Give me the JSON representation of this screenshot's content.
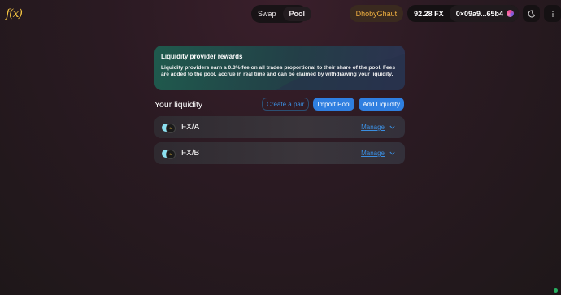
{
  "header": {
    "logo": "f(x)",
    "tabs": [
      {
        "label": "Swap"
      },
      {
        "label": "Pool"
      }
    ],
    "network": "DhobyGhaut",
    "balance": "92.28 FX",
    "address": "0×09a9...65b4"
  },
  "banner": {
    "title": "Liquidity provider rewards",
    "body": "Liquidity providers earn a 0.3% fee on all trades proportional to their share of the pool. Fees are added to the pool, accrue in real time and can be claimed by withdrawing your liquidity."
  },
  "liquidity": {
    "heading": "Your liquidity",
    "create_pair": "Create a pair",
    "import_pool": "Import Pool",
    "add_liquidity": "Add Liquidity",
    "pools": [
      {
        "name": "FX/A",
        "manage": "Manage"
      },
      {
        "name": "FX/B",
        "manage": "Manage"
      }
    ]
  },
  "colors": {
    "accent": "#2f7fe0",
    "network": "#f0b040"
  }
}
